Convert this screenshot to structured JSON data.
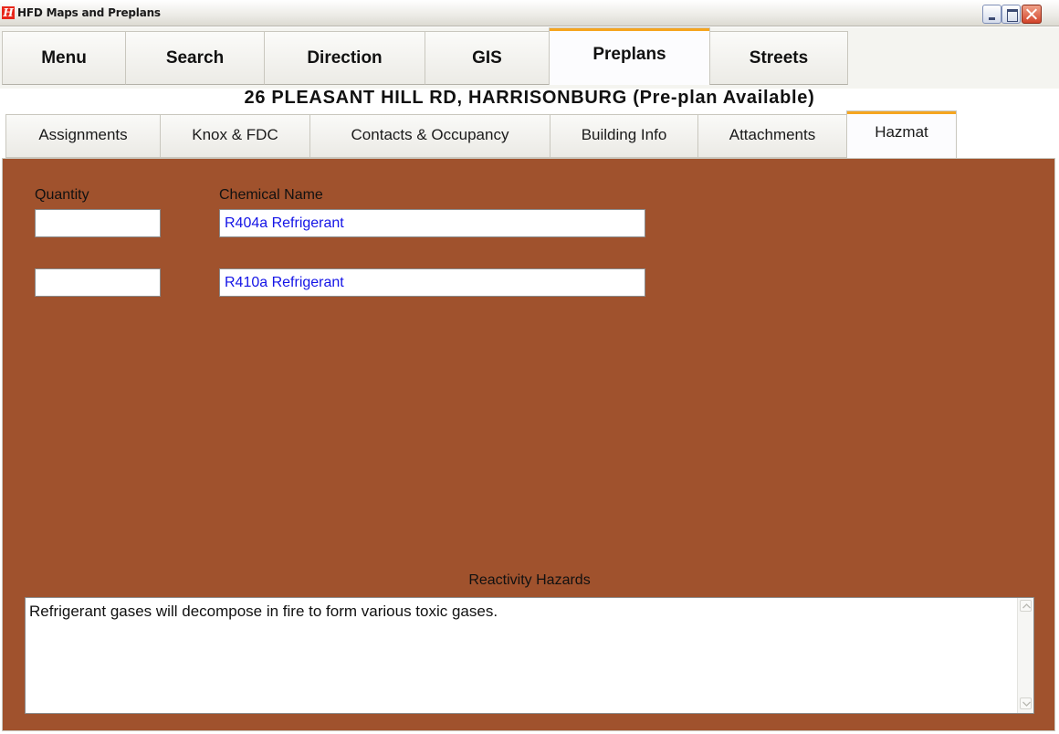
{
  "window": {
    "title": "HFD Maps and Preplans",
    "icon_glyph": "H"
  },
  "main_tabs": [
    {
      "label": "Menu",
      "active": false
    },
    {
      "label": "Search",
      "active": false
    },
    {
      "label": "Direction",
      "active": false
    },
    {
      "label": "GIS",
      "active": false
    },
    {
      "label": "Preplans",
      "active": true
    },
    {
      "label": "Streets",
      "active": false
    }
  ],
  "address_header": "26 PLEASANT HILL RD, HARRISONBURG (Pre-plan Available)",
  "sub_tabs": [
    {
      "label": "Assignments",
      "active": false
    },
    {
      "label": "Knox & FDC",
      "active": false
    },
    {
      "label": "Contacts & Occupancy",
      "active": false
    },
    {
      "label": "Building Info",
      "active": false
    },
    {
      "label": "Attachments",
      "active": false
    },
    {
      "label": "Hazmat",
      "active": true
    }
  ],
  "hazmat": {
    "quantity_label": "Quantity",
    "chemical_label": "Chemical Name",
    "rows": [
      {
        "quantity": "",
        "chemical": "R404a Refrigerant"
      },
      {
        "quantity": "",
        "chemical": "R410a Refrigerant"
      }
    ],
    "reactivity_label": "Reactivity Hazards",
    "reactivity_text": "Refrigerant gases will decompose in fire to form various toxic gases."
  },
  "colors": {
    "panel_bg": "#a0522d",
    "active_tab_accent": "#f5a51f",
    "chemical_text": "#1414e6"
  },
  "icons": [
    "app-logo-icon",
    "minimize-icon",
    "maximize-icon",
    "close-icon",
    "scroll-up-icon",
    "scroll-down-icon"
  ]
}
